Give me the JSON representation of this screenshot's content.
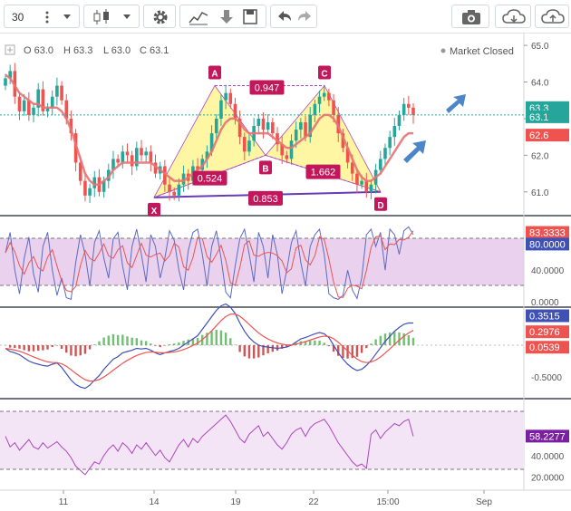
{
  "toolbar": {
    "interval": "30",
    "icons": [
      "more-vertical-icon",
      "chevron-down-icon",
      "candlestick-icon",
      "chevron-down-icon",
      "gear-icon",
      "indicators-icon",
      "download-icon",
      "save-icon",
      "undo-icon",
      "redo-icon",
      "camera-icon",
      "cloud-download-icon",
      "cloud-upload-icon"
    ]
  },
  "legend": {
    "open": "O 63.0",
    "high": "H 63.3",
    "low": "L 63.0",
    "close": "C 63.1",
    "status": "Market Closed"
  },
  "colors": {
    "up": "#26a69a",
    "down": "#ef5350",
    "ma": "#e57373",
    "pattern_fill": "#ffee58",
    "pattern_stroke": "#ab47bc",
    "pattern_label": "#c2185b",
    "stoch_k": "#5c6bc0",
    "stoch_d": "#ef5350",
    "rsi": "#ab47bc",
    "band": "#e1bee7",
    "arrow": "#4a86c8",
    "trendline": "#673ab7"
  },
  "price_axis": {
    "ticks": [
      "65.0",
      "64.0",
      "63.0",
      "62.0",
      "61.0"
    ],
    "badges": [
      {
        "text": "63.3",
        "color": "#26a69a"
      },
      {
        "text": "63.1",
        "color": "#26a69a"
      },
      {
        "text": "62.6",
        "color": "#ef5350"
      }
    ]
  },
  "stoch_axis": {
    "ticks": [
      "40.0000",
      "0.0000"
    ],
    "badges": [
      {
        "text": "83.3333",
        "color": "#ef5350"
      },
      {
        "text": "80.0000",
        "color": "#3f51b5"
      }
    ]
  },
  "macd_axis": {
    "ticks": [
      "-0.5000"
    ],
    "badges": [
      {
        "text": "0.3515",
        "color": "#3f51b5"
      },
      {
        "text": "0.2976",
        "color": "#ef5350"
      },
      {
        "text": "0.0539",
        "color": "#ef5350"
      }
    ]
  },
  "rsi_axis": {
    "ticks": [
      "40.0000",
      "20.0000"
    ],
    "badges": [
      {
        "text": "58.2277",
        "color": "#7b1fa2"
      }
    ]
  },
  "time_axis": {
    "labels": [
      "11",
      "14",
      "19",
      "22",
      "15:00",
      "Sep"
    ]
  },
  "pattern": {
    "points": [
      "X",
      "A",
      "B",
      "C",
      "D"
    ],
    "ratios": [
      "0.947",
      "0.524",
      "1.662",
      "0.853"
    ],
    "x_price": 60.85,
    "a_price": 63.9,
    "b_price": 62.0,
    "c_price": 63.9,
    "d_price": 61.0
  },
  "chart_data": {
    "type": "candlestick",
    "ylim": [
      60.5,
      65.2
    ],
    "closes": [
      64.1,
      64.3,
      63.6,
      63.2,
      63.5,
      63.1,
      63.3,
      63.8,
      63.2,
      63.3,
      63.6,
      63.9,
      63.5,
      63.0,
      62.6,
      61.8,
      61.3,
      60.9,
      61.1,
      61.4,
      61.0,
      61.3,
      61.6,
      61.9,
      61.8,
      62.1,
      62.0,
      61.7,
      62.2,
      62.0,
      62.1,
      61.8,
      61.5,
      61.7,
      61.2,
      61.0,
      60.9,
      61.2,
      61.5,
      61.3,
      61.7,
      61.6,
      61.9,
      62.1,
      62.6,
      63.0,
      63.5,
      63.7,
      63.4,
      63.0,
      62.5,
      62.1,
      62.4,
      62.8,
      63.0,
      62.7,
      62.9,
      62.6,
      62.3,
      62.0,
      61.9,
      62.4,
      62.7,
      62.9,
      62.5,
      63.1,
      63.4,
      63.6,
      63.7,
      63.5,
      63.1,
      62.6,
      62.2,
      61.8,
      61.5,
      61.2,
      61.3,
      61.0,
      61.2,
      61.6,
      61.9,
      62.2,
      62.5,
      62.8,
      63.1,
      63.4,
      63.3,
      63.1
    ],
    "ma20": [
      64.2,
      64.1,
      63.9,
      63.7,
      63.6,
      63.5,
      63.4,
      63.4,
      63.3,
      63.3,
      63.3,
      63.3,
      63.2,
      63.0,
      62.7,
      62.3,
      61.9,
      61.5,
      61.3,
      61.2,
      61.2,
      61.3,
      61.4,
      61.6,
      61.7,
      61.8,
      61.8,
      61.8,
      61.8,
      61.8,
      61.8,
      61.8,
      61.7,
      61.6,
      61.5,
      61.4,
      61.3,
      61.3,
      61.3,
      61.4,
      61.5,
      61.6,
      61.7,
      61.9,
      62.1,
      62.4,
      62.7,
      62.9,
      63.0,
      63.0,
      62.9,
      62.7,
      62.6,
      62.6,
      62.6,
      62.6,
      62.6,
      62.5,
      62.4,
      62.3,
      62.2,
      62.2,
      62.3,
      62.4,
      62.5,
      62.6,
      62.8,
      63.0,
      63.1,
      63.1,
      63.0,
      62.8,
      62.5,
      62.2,
      61.9,
      61.6,
      61.4,
      61.3,
      61.3,
      61.4,
      61.5,
      61.7,
      61.9,
      62.1,
      62.3,
      62.5,
      62.6,
      62.6
    ],
    "stoch": [
      62,
      88,
      40,
      10,
      55,
      82,
      35,
      12,
      70,
      88,
      40,
      8,
      30,
      5,
      3,
      50,
      85,
      60,
      20,
      75,
      90,
      55,
      30,
      80,
      88,
      45,
      15,
      70,
      92,
      60,
      25,
      85,
      70,
      30,
      55,
      90,
      78,
      40,
      15,
      65,
      88,
      92,
      60,
      20,
      70,
      90,
      55,
      12,
      5,
      45,
      80,
      92,
      60,
      25,
      88,
      70,
      30,
      85,
      60,
      10,
      40,
      75,
      90,
      50,
      20,
      70,
      85,
      92,
      60,
      10,
      5,
      3,
      8,
      40,
      15,
      4,
      30,
      85,
      92,
      70,
      88,
      40,
      92,
      85,
      60,
      90,
      95,
      85
    ],
    "macd": [
      -0.05,
      -0.1,
      -0.12,
      -0.15,
      -0.2,
      -0.25,
      -0.28,
      -0.3,
      -0.32,
      -0.33,
      -0.3,
      -0.28,
      -0.35,
      -0.45,
      -0.55,
      -0.62,
      -0.66,
      -0.68,
      -0.63,
      -0.55,
      -0.48,
      -0.38,
      -0.3,
      -0.22,
      -0.18,
      -0.12,
      -0.1,
      -0.08,
      -0.05,
      -0.06,
      -0.05,
      -0.08,
      -0.12,
      -0.15,
      -0.12,
      -0.1,
      -0.08,
      -0.05,
      0.0,
      0.05,
      0.1,
      0.15,
      0.25,
      0.35,
      0.45,
      0.55,
      0.62,
      0.65,
      0.6,
      0.5,
      0.35,
      0.22,
      0.12,
      0.05,
      0.0,
      -0.02,
      -0.03,
      -0.04,
      -0.05,
      -0.04,
      -0.03,
      0.0,
      0.05,
      0.1,
      0.12,
      0.15,
      0.18,
      0.2,
      0.18,
      0.12,
      0.0,
      -0.12,
      -0.22,
      -0.3,
      -0.36,
      -0.4,
      -0.38,
      -0.32,
      -0.24,
      -0.14,
      -0.04,
      0.06,
      0.14,
      0.22,
      0.28,
      0.33,
      0.35,
      0.35
    ],
    "rsi": [
      58,
      48,
      52,
      45,
      50,
      55,
      48,
      46,
      52,
      47,
      50,
      53,
      48,
      44,
      38,
      30,
      26,
      22,
      28,
      34,
      32,
      40,
      46,
      50,
      44,
      52,
      48,
      42,
      50,
      46,
      52,
      46,
      40,
      45,
      38,
      34,
      42,
      50,
      55,
      48,
      56,
      52,
      58,
      62,
      66,
      70,
      74,
      78,
      72,
      64,
      56,
      52,
      60,
      64,
      68,
      58,
      62,
      56,
      50,
      46,
      52,
      60,
      64,
      66,
      58,
      66,
      70,
      72,
      74,
      68,
      60,
      52,
      46,
      40,
      34,
      30,
      32,
      28,
      60,
      64,
      56,
      62,
      66,
      70,
      68,
      72,
      74,
      58
    ]
  }
}
